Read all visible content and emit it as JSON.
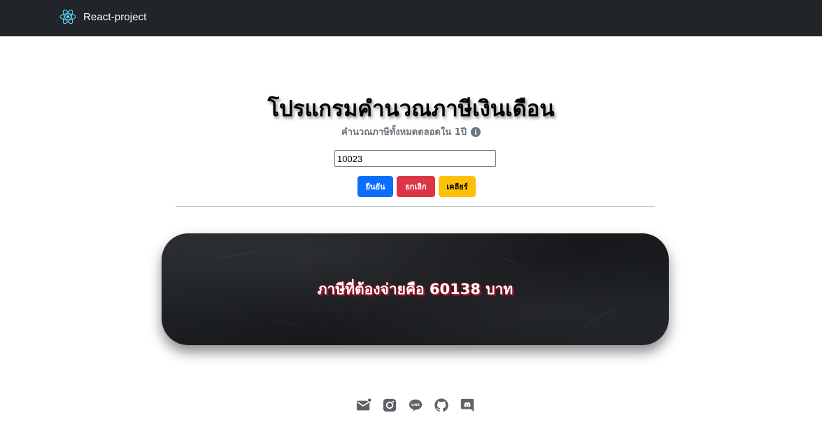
{
  "navbar": {
    "brand_label": "React-project",
    "logo_icon": "react-logo-icon",
    "logo_color": "#61dafb",
    "background": "#212529"
  },
  "main": {
    "title": "โปรแกรมคำนวณภาษีเงินเดือน",
    "subtitle": "คำนวณภาษีทั้งหมดตลอดใน 1ปี",
    "info_icon": "info-circle-icon",
    "amount_input": {
      "value": "10023",
      "placeholder": ""
    },
    "buttons": {
      "confirm_label": "ยืนยัน",
      "cancel_label": "ยกเลิก",
      "clear_label": "เคลียร์"
    },
    "colors": {
      "confirm": "#0d6efd",
      "cancel": "#dc3545",
      "clear": "#ffc107"
    }
  },
  "result": {
    "text": "ภาษีที่ต้องจ่ายคือ 60138 บาท"
  },
  "footer": {
    "icons": [
      "mail-icon",
      "instagram-icon",
      "line-icon",
      "github-icon",
      "discord-icon"
    ],
    "icon_color": "#5f6368"
  }
}
